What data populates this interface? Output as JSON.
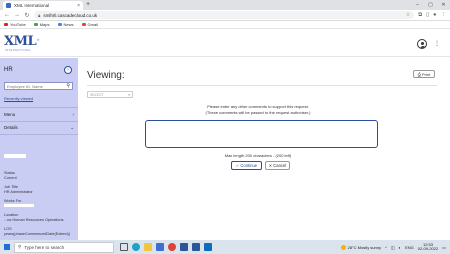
{
  "browser": {
    "tab_title": "XML International",
    "tab_close": "×",
    "new_tab": "+",
    "window_controls": [
      "–",
      "▢",
      "✕"
    ],
    "back": "←",
    "forward": "→",
    "reload": "↻",
    "url": "smlhrli.cascadecloud.co.uk",
    "bookmarks": [
      {
        "label": "YouTube",
        "color": "#e62117"
      },
      {
        "label": "Maps",
        "color": "#34a853"
      },
      {
        "label": "News",
        "color": "#4285f4"
      },
      {
        "label": "Gmail",
        "color": "#ea4335"
      }
    ]
  },
  "header": {
    "logo_text": "XML",
    "logo_tagline": "INTERNATIONAL"
  },
  "sidebar": {
    "title": "HR",
    "search_placeholder": "Employee ID, Name",
    "recently_viewed": "Recently viewed",
    "menu_label": "Menu",
    "details_label": "Details",
    "fields": [
      {
        "label": "Status",
        "value": "Current"
      },
      {
        "label": "Job Title",
        "value": "HR Administrator"
      },
      {
        "label": "Works For",
        "value": ""
      },
      {
        "label": "Location",
        "value": "...na Human Resources Operations"
      },
      {
        "label": "LOS",
        "value": "years(phaseCommencedDate(Extend))"
      }
    ]
  },
  "main": {
    "title": "Viewing:",
    "print_label": "Print",
    "dropdown_value": "SELECT",
    "prompt_line1": "Please enter any other comments to support this request.",
    "prompt_line2": "(These comments will be passed to the request authoriser.)",
    "comment_value": "",
    "max_length_text": "Max length 200 characters - (200 left)",
    "continue_label": "Continue",
    "cancel_label": "Cancel"
  },
  "taskbar": {
    "search_placeholder": "Type here to search",
    "weather": "28°C  Mostly sunny",
    "language": "ENG",
    "time": "12:53",
    "date": "02-09-2022"
  },
  "colors": {
    "accent": "#2b4d9a",
    "sidebar_bg": "#c9cdf3"
  }
}
